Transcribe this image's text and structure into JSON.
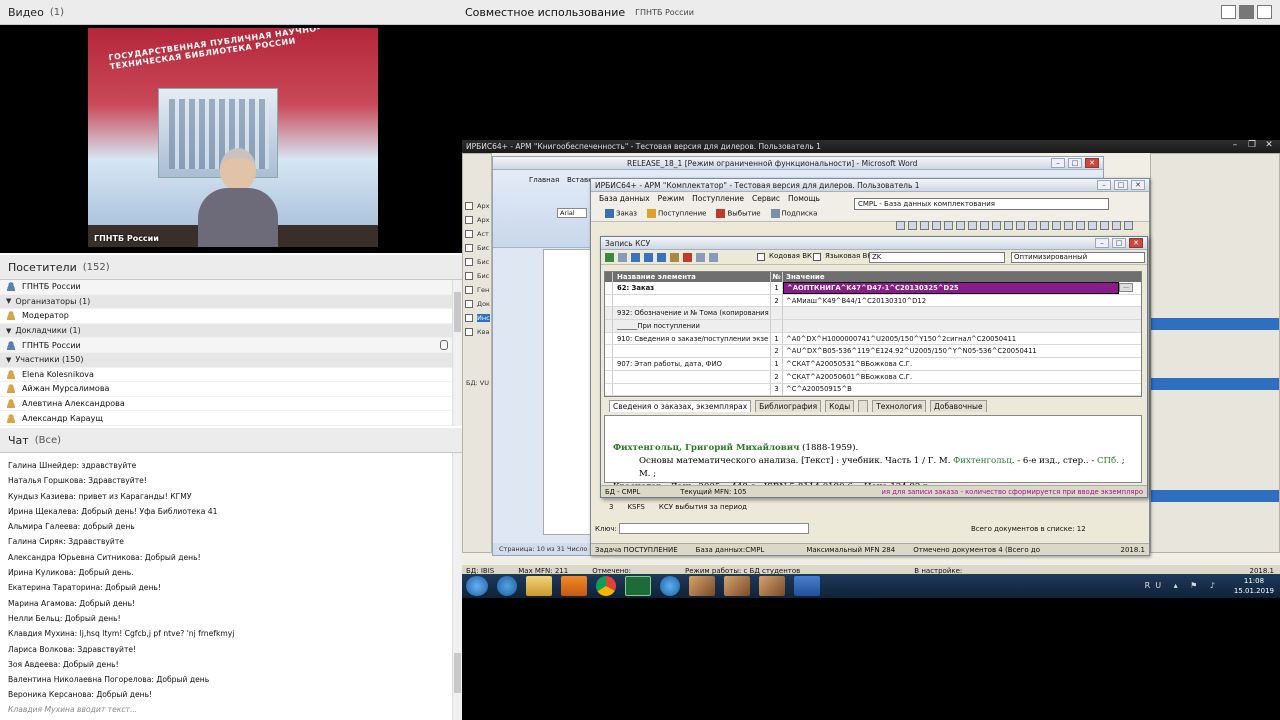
{
  "left": {
    "video_pod": {
      "title": "Видео",
      "count": "(1)",
      "feed_label": "ГПНТБ России",
      "banner": "ГОСУДАРСТВЕННАЯ ПУБЛИЧНАЯ НАУЧНО-ТЕХНИЧЕСКАЯ БИБЛИОТЕКА РОССИИ"
    },
    "attendees_pod": {
      "title": "Посетители",
      "count": "(152)",
      "host_entry": "ГПНТБ России",
      "groups": [
        {
          "label": "Организаторы (1)",
          "members": [
            "Модератор"
          ]
        },
        {
          "label": "Докладчики (1)",
          "members": [
            "ГПНТБ России"
          ]
        },
        {
          "label": "Участники (150)",
          "members": [
            "Elena Kolesnikova",
            "Айжан Мурсалимова",
            "Алевтина Александрова",
            "Александр Караущ"
          ]
        }
      ]
    },
    "chat_pod": {
      "title": "Чат",
      "scope": "(Все)",
      "messages": [
        "Галина Шнейдер: здравствуйте",
        "Наталья Горшкова: Здравствуйте!",
        "Кундыз Казиева: привет из Караганды! КГМУ",
        "Ирина Щекалева: Добрый день! Уфа Библиотека 41",
        "Альмира Галеева: добрый день",
        "Галина Сиряк: Здравствуйте",
        "Александра Юрьевна Ситникова: Добрый день!",
        "Ирина Куликова: Добрый день.",
        "Екатерина Тараторина: Добрый день!",
        "Марина Агамова: Добрый день!",
        "Нелли Бельц: Добрый день!",
        "Клавдия  Мухина: lj,hsq ltym! Cgfcb,j pf ntve? 'nj frnefkmyj",
        "Лариса Волкова: Здравствуйте!",
        "Зоя Авдеева: Добрый день!",
        "Валентина Николаевна Погорелова: Добрый день",
        "Вероника Керсанова: Добрый день!"
      ],
      "typing": "Клавдия  Мухина вводит текст..."
    }
  },
  "share": {
    "title": "Совместное использование",
    "source": "ГПНТБ России"
  },
  "desktop": {
    "irbis_main_title": "ИРБИС64+ - АРМ \"Книгообеспеченность\" - Тестовая версия для дилеров. Пользователь 1",
    "word_title": "RELEASE_18_1 [Режим ограниченной функциональности] - Microsoft Word",
    "word_tabs": [
      "Главная",
      "Вставка"
    ],
    "word_font": "Arial",
    "word_status": "Страница: 10 из 31  Число с",
    "kompl": {
      "title": "ИРБИС64+ - АРМ \"Комплектатор\" - Тестовая версия для дилеров. Пользователь 1",
      "menu": [
        "База данных",
        "Режим",
        "Поступление",
        "Сервис",
        "Помощь"
      ],
      "db": "CMPL - База данных комплектования",
      "toolbar": [
        "Заказ",
        "Поступление",
        "Выбытие",
        "Подписка"
      ]
    },
    "ksu": {
      "title": "Запись КСУ",
      "code_vk": "Кодовая ВК",
      "lang_vk": "Языковая ВК",
      "zk": "ZK",
      "mode": "Оптимизированный",
      "columns": [
        "Название элемента",
        "№",
        "Значение"
      ],
      "rows": [
        {
          "name": "62: Заказ",
          "n": "1",
          "value": "^AОПТКНИГА^K47^D47-1^C20130325^D25",
          "selected": true,
          "bold": true
        },
        {
          "name": "",
          "n": "2",
          "value": "^AМиаш^K49^B44/1^C20130310^D12"
        },
        {
          "name": "932: Обозначение и № Тома (копирования",
          "n": "",
          "value": "",
          "gray": true
        },
        {
          "name": "______При поступлении",
          "n": "",
          "value": ""
        },
        {
          "name": "910: Сведения о заказе/поступлении экзе",
          "n": "1",
          "value": "^A0^DX^H1000000741^U2005/150^Y150^2сигнал^C20050411"
        },
        {
          "name": "",
          "n": "2",
          "value": "^AU^DX^B05-536^119^E124.92^U2005/150^Y^N05-536^C20050411"
        },
        {
          "name": "907: Этап работы, дата, ФИО",
          "n": "1",
          "value": "^CКАТ^A20050531^BБожкова С.Г."
        },
        {
          "name": "",
          "n": "2",
          "value": "^CКАТ^A20050601^BБожкова С.Г."
        },
        {
          "name": "",
          "n": "3",
          "value": "^C^A20050915^B"
        }
      ],
      "tabs": [
        "Сведения о заказах, экземплярах",
        "Библиография",
        "Коды",
        "",
        "Технология",
        "Добавочные"
      ],
      "preview_author": "Фихтенгольц, Григорий Михайлович",
      "preview_years": "(1888-1959).",
      "preview_line1_a": "Основы математического анализа. [Текст] : учебник. Часть 1 / Г. М. ",
      "preview_hl": "Фихтенгольц",
      "preview_line1_b": ". - 6-е изд., стер.. - ",
      "preview_city": "СПб.",
      "preview_line1_c": " ; М. ;",
      "preview_line2": "Краснодар : Лань, 2005. - 448 с.  -ISBN 5-8114-0190-6. - Цена:124.92 р.",
      "status_db": "БД - CMPL",
      "status_mfn": "Текущий MFN: 105",
      "status_warn": "ия для записи заказа - количество сформируется при вводе экземпляро"
    },
    "kompl_lower": {
      "row_num": "3",
      "row_code": "KSFS",
      "row_text": "КСУ выбытия за период",
      "key_label": "Ключ:",
      "total": "Всего документов в списке: 12"
    },
    "kompl_status": {
      "task": "Задача ПОСТУПЛЕНИЕ",
      "db": "База данных:CMPL",
      "max_mfn": "Максимальный MFN 284",
      "marked": "Отмечено документов 4 (Всего до",
      "version": "2018.1"
    },
    "main_status": {
      "db": "БД: IBIS",
      "max": "Max MFN: 211",
      "marked": "Отмечено:",
      "mode": "Режим работы: с БД студентов",
      "settings": "В настройке:",
      "version": "2018.1"
    },
    "main_left": {
      "db_label": "БД: VU",
      "key_label": "Ключ:",
      "items": [
        "Арх",
        "Арх",
        "Аст",
        "Бис",
        "Бис",
        "Бис",
        "Ген",
        "Док",
        "Инс",
        "Ква"
      ]
    }
  },
  "taskbar": {
    "time": "11:08",
    "date": "15.01.2019",
    "lang": "RU"
  }
}
